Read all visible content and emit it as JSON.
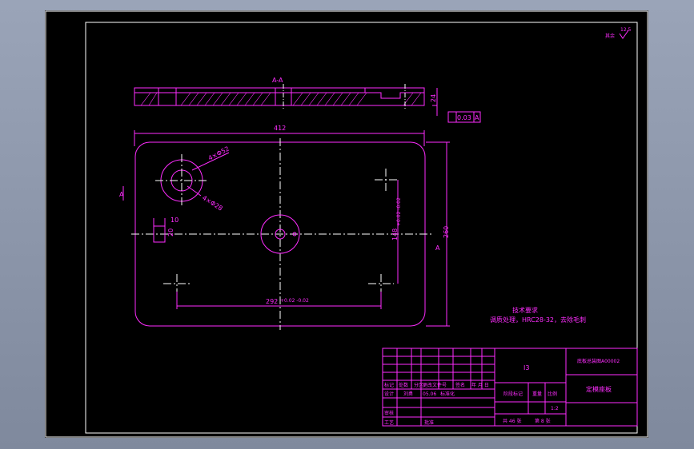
{
  "drawing": {
    "section_label": "A-A",
    "view_label": "A",
    "roughness_corner": "其余",
    "roughness_value": "12.5",
    "flatness_label": "0.03",
    "datum_ref": "A",
    "dims": {
      "width": "412",
      "height": "260",
      "thickness": "24",
      "hole_large": "4×Φ52",
      "hole_small": "4×Φ28",
      "slot_w": "10",
      "slot_h": "20",
      "pitch_y": "148",
      "pitch_y_tol": "+0.02 -0.02",
      "pitch_x": "292",
      "pitch_x_tol": "+0.02 -0.02"
    },
    "tech_title": "技术要求",
    "tech_note": "调质处理，HRC28-32，去除毛刺"
  },
  "title_block": {
    "material": "I3",
    "drawing_no": "底板总装图A00002",
    "part_name": "定模座板",
    "scale": "1:2",
    "sheets": "共 46 张",
    "sheet_no": "第 8 张",
    "stage": "阶段标记",
    "weight": "重量",
    "ratio": "比例",
    "h1": "标记",
    "h2": "处数",
    "h3": "分区",
    "h4": "更改文件号",
    "h5": "签名",
    "h6": "年 月 日",
    "r1": "设计",
    "r2": "刘勇",
    "r3": "05.06",
    "r4": "标准化",
    "r5": "审核",
    "r6": "工艺",
    "r7": "批准"
  }
}
